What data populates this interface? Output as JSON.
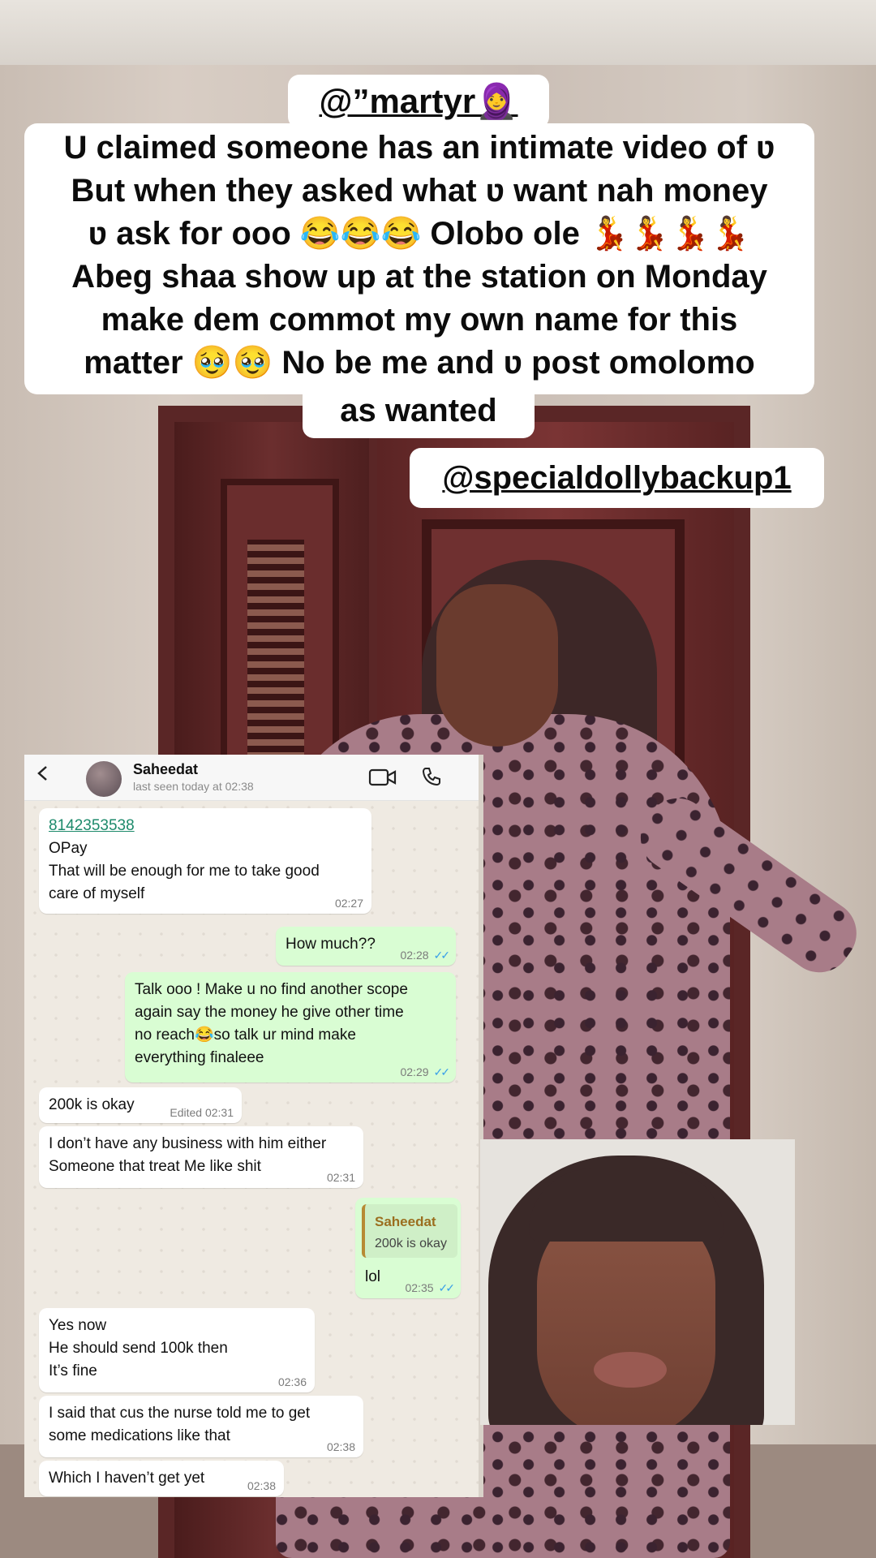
{
  "captions": {
    "username": "@”martyr🧕",
    "lines": [
      "U claimed someone has an intimate video of ʋ",
      "But when they asked what ʋ want nah money",
      "ʋ ask for ooo 😂😂😂 Olobo ole 💃💃💃💃",
      "Abeg shaa show up at the station on Monday",
      "make dem commot my own name for this",
      "matter 🥹🥹 No be me and ʋ post omolomo"
    ],
    "last_line": "as wanted",
    "mention": "@specialdollybackup1"
  },
  "chat": {
    "contact_name": "Saheedat",
    "last_seen": "last seen today at 02:38",
    "messages": [
      {
        "dir": "in",
        "link": "8142353538",
        "text_lines": [
          "OPay",
          "That will be enough for me to take good",
          "care of myself"
        ],
        "time": "02:27"
      },
      {
        "dir": "out",
        "text_lines": [
          "How much??"
        ],
        "time": "02:28",
        "ticks": "✓✓"
      },
      {
        "dir": "out",
        "text_lines": [
          "Talk ooo ! Make u no find another scope",
          "again say the money he give other time",
          "no reach😂so talk ur mind make",
          "everything finaleee"
        ],
        "time": "02:29",
        "ticks": "✓✓"
      },
      {
        "dir": "in",
        "text_lines": [
          "200k is okay"
        ],
        "time": "Edited 02:31"
      },
      {
        "dir": "in",
        "text_lines": [
          "I don’t have any business with him either",
          "Someone that treat Me like shit"
        ],
        "time": "02:31"
      },
      {
        "dir": "out",
        "quote_name": "Saheedat",
        "quote_text": "200k is okay",
        "text_lines": [
          "lol"
        ],
        "time": "02:35",
        "ticks": "✓✓"
      },
      {
        "dir": "in",
        "text_lines": [
          "Yes now",
          "He should send 100k then",
          "It’s fine"
        ],
        "time": "02:36"
      },
      {
        "dir": "in",
        "text_lines": [
          "I said that cus the nurse told me to get",
          "some medications like that"
        ],
        "time": "02:38"
      },
      {
        "dir": "in",
        "text_lines": [
          "Which I haven’t get yet"
        ],
        "time": "02:38"
      }
    ]
  },
  "icons": [
    "back-arrow-icon",
    "video-call-icon",
    "voice-call-icon"
  ],
  "colors": {
    "outgoing_bubble": "#d9fdd3",
    "incoming_bubble": "#ffffff",
    "chat_background": "#efeae2",
    "link": "#1d8a6b",
    "read_ticks": "#3aa0e8"
  }
}
